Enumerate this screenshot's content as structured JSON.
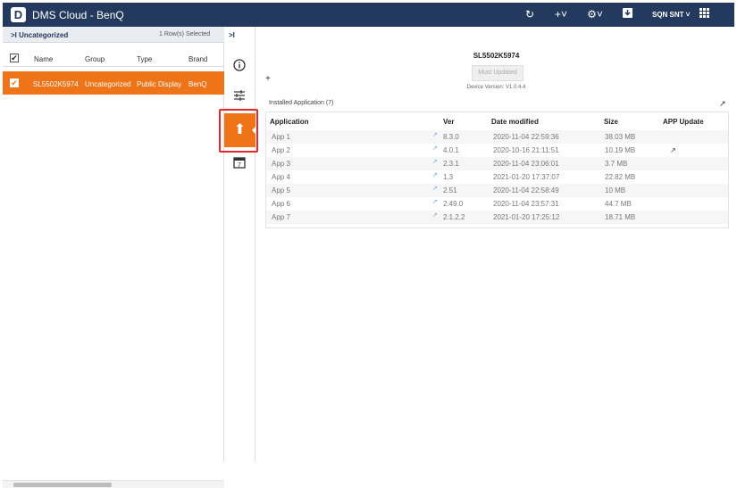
{
  "app": {
    "title": "DMS Cloud - BenQ",
    "logo": "D",
    "user": "SQN SNT"
  },
  "toolbar_icons": [
    "refresh-icon",
    "add-dropdown-icon",
    "settings-dropdown-icon",
    "download-icon",
    "user-dropdown-icon",
    "apps-grid-icon"
  ],
  "left": {
    "group_label": ">I Uncategorized",
    "selected_count": "1 Row(s) Selected",
    "columns": [
      "Name",
      "Group",
      "Type",
      "Brand"
    ],
    "rows": [
      {
        "name": "SL5502K5974",
        "group": "Uncategorized",
        "type": "Public Display",
        "brand": "BenQ"
      }
    ]
  },
  "rail": {
    "expand": ">I",
    "icons": [
      "info-icon",
      "sliders-icon",
      "upload-icon",
      "calendar-icon"
    ],
    "calendar_day": "7"
  },
  "detail": {
    "device_name": "SL5502K5974",
    "update_button": "Must Updated",
    "device_version": "Device Version: V1.0.4.4",
    "installed_label": "Installed Application (7)",
    "columns": [
      "Application",
      "Ver",
      "Date modified",
      "Size",
      "APP Update"
    ],
    "apps": [
      {
        "name": "App 1",
        "ver": "8.3.0",
        "date": "2020-11-04 22:59:36",
        "size": "38.03 MB",
        "update": ""
      },
      {
        "name": "App 2",
        "ver": "4.0.1",
        "date": "2020-10-16 21:11:51",
        "size": "10.19 MB",
        "update": "trend"
      },
      {
        "name": "App 3",
        "ver": "2.3.1",
        "date": "2020-11-04 23:06:01",
        "size": "3.7 MB",
        "update": ""
      },
      {
        "name": "App 4",
        "ver": "1.3",
        "date": "2021-01-20 17:37:07",
        "size": "22.82 MB",
        "update": ""
      },
      {
        "name": "App 5",
        "ver": "2.51",
        "date": "2020-11-04 22:58:49",
        "size": "10 MB",
        "update": ""
      },
      {
        "name": "App 6",
        "ver": "2.49.0",
        "date": "2020-11-04 23:57:31",
        "size": "44.7 MB",
        "update": ""
      },
      {
        "name": "App 7",
        "ver": "2.1.2.2",
        "date": "2021-01-20 17:25:12",
        "size": "18.71 MB",
        "update": ""
      }
    ]
  },
  "colors": {
    "header": "#233a5e",
    "accent": "#ef7418",
    "highlight": "#e5282b"
  }
}
